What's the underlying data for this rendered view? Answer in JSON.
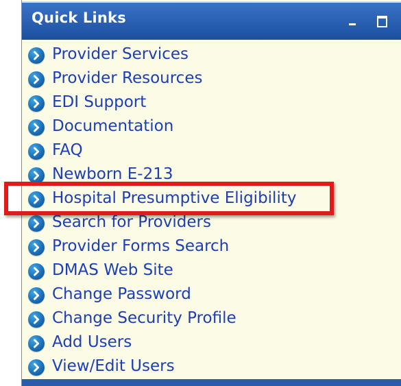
{
  "panel": {
    "title": "Quick Links"
  },
  "links": [
    {
      "label": "Provider Services"
    },
    {
      "label": "Provider Resources"
    },
    {
      "label": "EDI Support"
    },
    {
      "label": "Documentation"
    },
    {
      "label": "FAQ"
    },
    {
      "label": "Newborn E-213"
    },
    {
      "label": "Hospital Presumptive Eligibility"
    },
    {
      "label": "Search for Providers"
    },
    {
      "label": "Provider Forms Search"
    },
    {
      "label": "DMAS Web Site"
    },
    {
      "label": "Change Password"
    },
    {
      "label": "Change Security Profile"
    },
    {
      "label": "Add Users"
    },
    {
      "label": "View/Edit Users"
    }
  ],
  "colors": {
    "header": "#1c4f9e",
    "panel_background": "#fbfbe6",
    "link_text": "#1d3fb5",
    "highlight": "#e01b1b"
  },
  "icons": {
    "bullet": "chevron-right-circle-icon",
    "minimize": "minimize-icon",
    "maximize": "maximize-icon"
  }
}
